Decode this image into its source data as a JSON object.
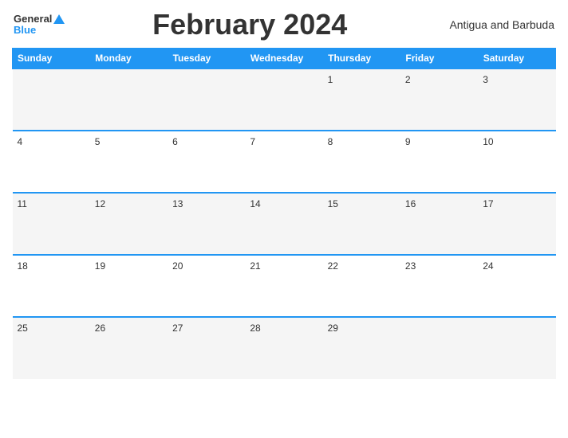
{
  "header": {
    "logo_general": "General",
    "logo_blue": "Blue",
    "month_title": "February 2024",
    "country": "Antigua and Barbuda"
  },
  "days_of_week": [
    "Sunday",
    "Monday",
    "Tuesday",
    "Wednesday",
    "Thursday",
    "Friday",
    "Saturday"
  ],
  "weeks": [
    [
      null,
      null,
      null,
      null,
      1,
      2,
      3
    ],
    [
      4,
      5,
      6,
      7,
      8,
      9,
      10
    ],
    [
      11,
      12,
      13,
      14,
      15,
      16,
      17
    ],
    [
      18,
      19,
      20,
      21,
      22,
      23,
      24
    ],
    [
      25,
      26,
      27,
      28,
      29,
      null,
      null
    ]
  ]
}
